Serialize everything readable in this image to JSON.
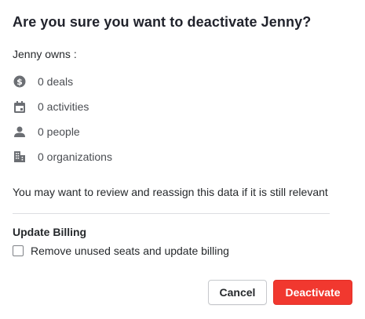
{
  "dialog": {
    "title": "Are you sure you want to deactivate Jenny?",
    "owns_label": "Jenny owns :",
    "items": [
      {
        "icon": "dollar-icon",
        "label": "0 deals"
      },
      {
        "icon": "calendar-icon",
        "label": "0 activities"
      },
      {
        "icon": "person-icon",
        "label": "0 people"
      },
      {
        "icon": "building-icon",
        "label": "0 organizations"
      }
    ],
    "note": "You may want to review and reassign this data if it is still relevant",
    "billing": {
      "title": "Update Billing",
      "checkbox_label": "Remove unused seats and update billing",
      "checked": false
    },
    "buttons": {
      "cancel": "Cancel",
      "deactivate": "Deactivate"
    }
  },
  "colors": {
    "deactivate_bg": "#f1382f",
    "icon": "#6b6e73",
    "divider": "#dcdee2"
  }
}
